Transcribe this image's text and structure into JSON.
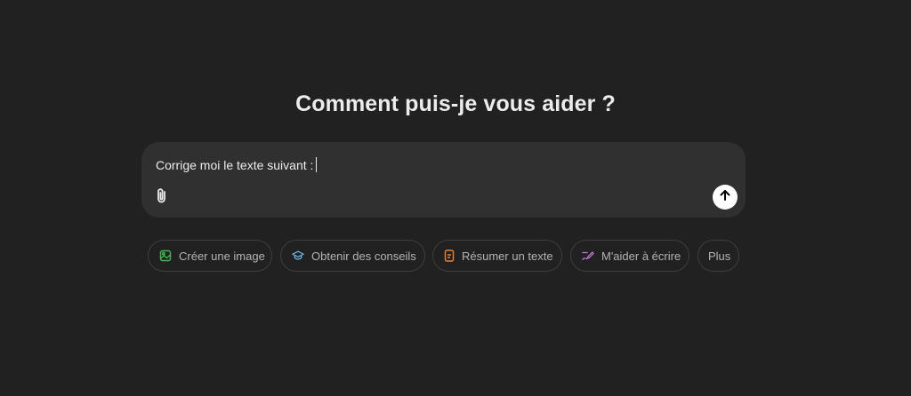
{
  "main": {
    "heading": "Comment puis-je vous aider ?",
    "composer": {
      "value": "Corrige moi le texte suivant :"
    }
  },
  "suggestions": [
    {
      "label": "Créer une image",
      "icon": "image-icon",
      "color": "#3fb950"
    },
    {
      "label": "Obtenir des conseils",
      "icon": "graduation-cap-icon",
      "color": "#6cb8e6"
    },
    {
      "label": "Résumer un texte",
      "icon": "document-icon",
      "color": "#e8833a"
    },
    {
      "label": "M'aider à écrire",
      "icon": "pen-icon",
      "color": "#c27bd8"
    },
    {
      "label": "Plus",
      "icon": null
    }
  ]
}
